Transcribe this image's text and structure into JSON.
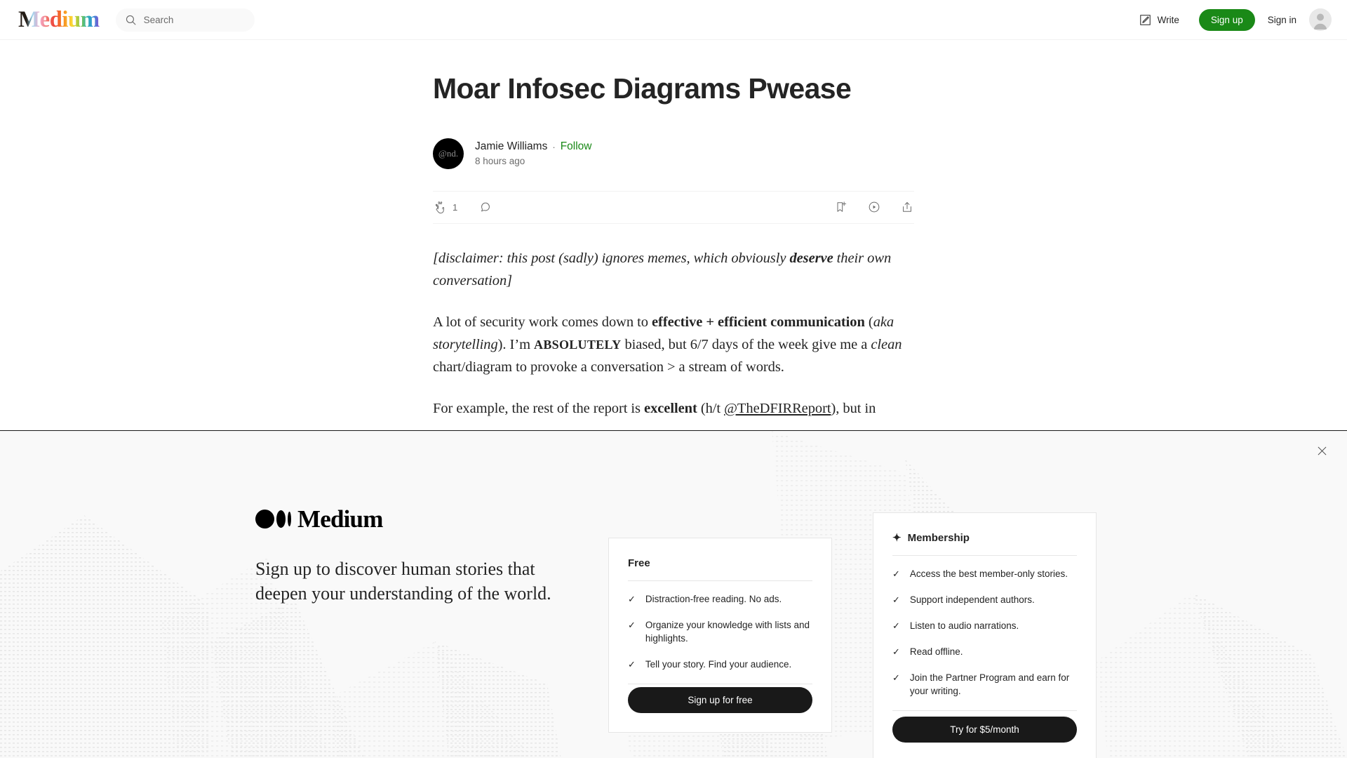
{
  "header": {
    "logo_text": "Medium",
    "search_placeholder": "Search",
    "search_value": "",
    "write_label": "Write",
    "signup_label": "Sign up",
    "signin_label": "Sign in"
  },
  "article": {
    "title": "Moar Infosec Diagrams Pwease",
    "author_name": "Jamie Williams",
    "author_avatar_text": "@nd.",
    "separator": "·",
    "follow_label": "Follow",
    "timestamp": "8 hours ago",
    "clap_count": "1",
    "paragraphs": [
      {
        "style": "italic",
        "runs": [
          {
            "text": "[disclaimer: this post (sadly) ignores memes, which obviously ",
            "fmt": "plain"
          },
          {
            "text": "deserve",
            "fmt": "bold"
          },
          {
            "text": " their own conversation]",
            "fmt": "plain"
          }
        ]
      },
      {
        "style": "normal",
        "runs": [
          {
            "text": "A lot of security work comes down to ",
            "fmt": "plain"
          },
          {
            "text": "effective + efficient communication",
            "fmt": "bold"
          },
          {
            "text": " (",
            "fmt": "plain"
          },
          {
            "text": "aka storytelling",
            "fmt": "italic"
          },
          {
            "text": "). I’m ",
            "fmt": "plain"
          },
          {
            "text": "ABSOLUTELY",
            "fmt": "smallcaps"
          },
          {
            "text": " biased, but 6/7 days of the week give me a ",
            "fmt": "plain"
          },
          {
            "text": "clean",
            "fmt": "italic"
          },
          {
            "text": " chart/diagram to provoke a conversation > a stream of words.",
            "fmt": "plain"
          }
        ]
      },
      {
        "style": "normal",
        "runs": [
          {
            "text": "For example, the rest of the report is ",
            "fmt": "plain"
          },
          {
            "text": "excellent",
            "fmt": "bold"
          },
          {
            "text": " (h/t ",
            "fmt": "plain"
          },
          {
            "text": "@TheDFIRReport",
            "fmt": "link"
          },
          {
            "text": "), but in",
            "fmt": "plain"
          }
        ]
      }
    ]
  },
  "banner": {
    "logo_word": "Medium",
    "tagline": "Sign up to discover human stories that deepen your understanding of the world.",
    "free_card": {
      "title": "Free",
      "items": [
        "Distraction-free reading. No ads.",
        "Organize your knowledge with lists and highlights.",
        "Tell your story. Find your audience."
      ],
      "button_label": "Sign up for free"
    },
    "membership_card": {
      "title": "Membership",
      "items": [
        "Access the best member-only stories.",
        "Support independent authors.",
        "Listen to audio narrations.",
        "Read offline.",
        "Join the Partner Program and earn for your writing."
      ],
      "button_label": "Try for $5/month"
    },
    "check_glyph": "✓",
    "sparkle_glyph": "✦"
  },
  "colors": {
    "brand_green": "#1a8917",
    "text_primary": "#242424",
    "text_muted": "#6b6b6b",
    "banner_bg": "#f9f9f9",
    "button_dark": "#191919"
  }
}
